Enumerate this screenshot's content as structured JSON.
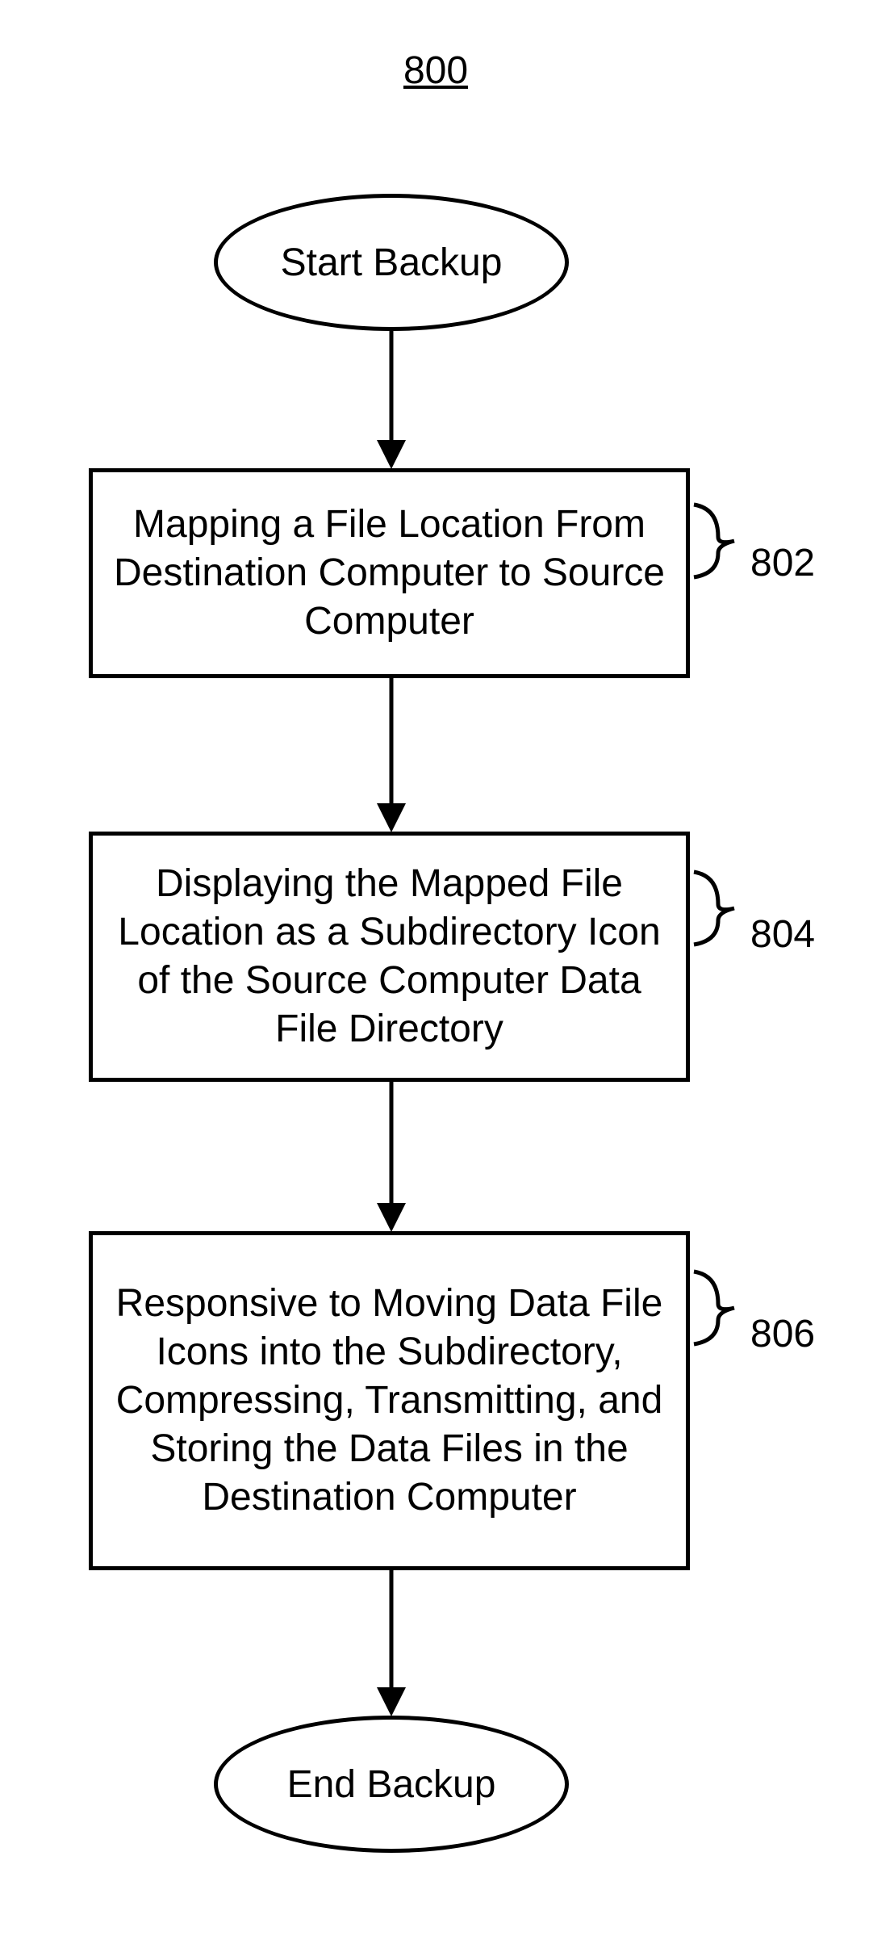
{
  "title": "800",
  "start_label": "Start Backup",
  "step1": {
    "text": "Mapping a File Location From Destination Computer to Source Computer",
    "num": "802"
  },
  "step2": {
    "text": "Displaying the Mapped File Location as a Subdirectory Icon of the Source Computer Data File Directory",
    "num": "804"
  },
  "step3": {
    "text": "Responsive to Moving Data File Icons into the Subdirectory, Compressing, Transmitting, and Storing the Data Files in the Destination Computer",
    "num": "806"
  },
  "end_label": "End Backup"
}
